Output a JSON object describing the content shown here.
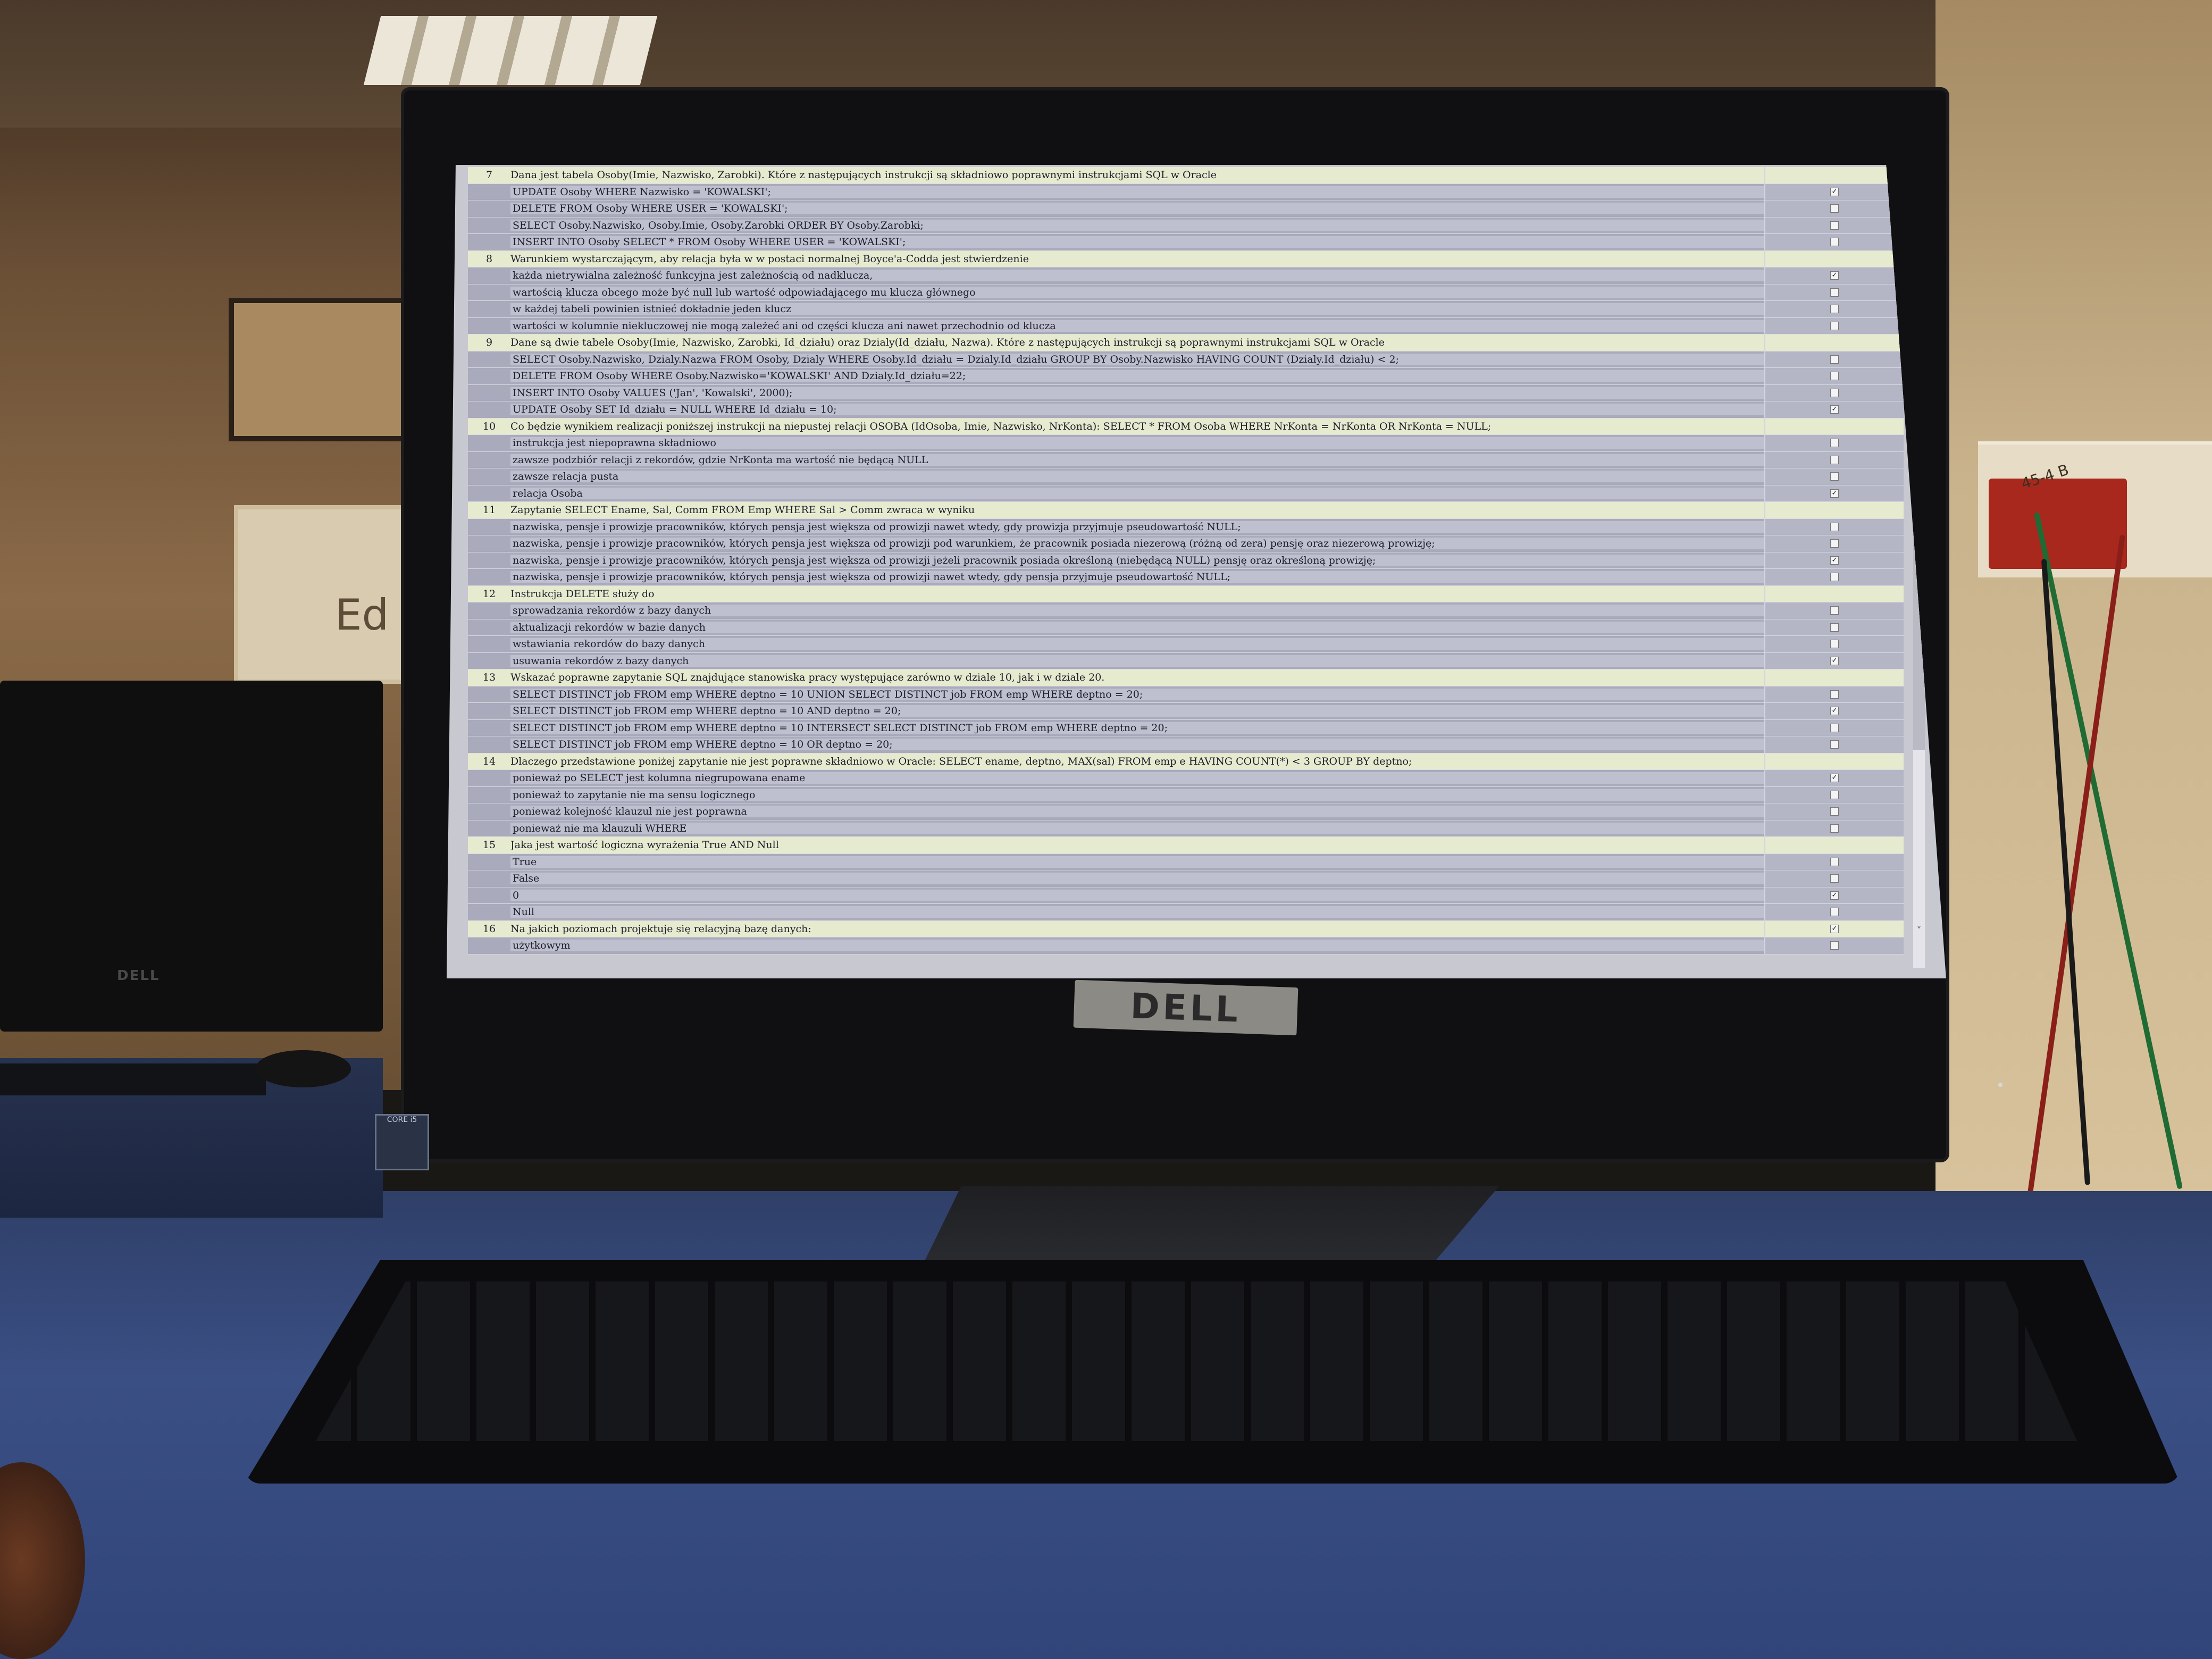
{
  "monitor": {
    "brand": "DELL",
    "left_monitor_brand": "DELL",
    "sticker": "CORE i5"
  },
  "outlet_label": "45-4 B",
  "whiteboard_text": "Ed",
  "colors": {
    "question_row": "#e6ebcf",
    "answer_row": "#a9aabb",
    "screen_bg": "#c8c9d0"
  },
  "questions": [
    {
      "number": "7",
      "text": "Dana jest tabela Osoby(Imie, Nazwisko, Zarobki). Które z następujących instrukcji są składniowo poprawnymi instrukcjami SQL w Oracle",
      "answers": [
        {
          "text": "UPDATE Osoby WHERE Nazwisko = 'KOWALSKI';",
          "checked": true
        },
        {
          "text": "DELETE FROM Osoby WHERE USER = 'KOWALSKI';",
          "checked": false
        },
        {
          "text": "SELECT Osoby.Nazwisko, Osoby.Imie, Osoby.Zarobki ORDER BY Osoby.Zarobki;",
          "checked": false
        },
        {
          "text": "INSERT INTO Osoby SELECT * FROM Osoby WHERE USER = 'KOWALSKI';",
          "checked": false
        }
      ]
    },
    {
      "number": "8",
      "text": "Warunkiem wystarczającym, aby relacja była w w postaci normalnej Boyce'a-Codda jest stwierdzenie",
      "answers": [
        {
          "text": "każda nietrywialna zależność funkcyjna jest zależnością od nadklucza,",
          "checked": true
        },
        {
          "text": "wartością klucza obcego może być null lub wartość odpowiadającego mu klucza głównego",
          "checked": false
        },
        {
          "text": "w każdej tabeli powinien istnieć dokładnie jeden klucz",
          "checked": false
        },
        {
          "text": "wartości w kolumnie niekluczowej nie mogą zależeć ani od części klucza ani nawet przechodnio od klucza",
          "checked": false
        }
      ]
    },
    {
      "number": "9",
      "text": "Dane są dwie tabele Osoby(Imie, Nazwisko, Zarobki, Id_działu) oraz Dzialy(Id_działu, Nazwa). Które z następujących instrukcji są poprawnymi instrukcjami SQL w Oracle",
      "answers": [
        {
          "text": "SELECT Osoby.Nazwisko, Dzialy.Nazwa FROM Osoby, Dzialy WHERE Osoby.Id_działu = Dzialy.Id_działu GROUP BY Osoby.Nazwisko HAVING COUNT (Dzialy.Id_działu) < 2;",
          "checked": false
        },
        {
          "text": "DELETE FROM Osoby WHERE Osoby.Nazwisko='KOWALSKI' AND Dzialy.Id_działu=22;",
          "checked": false
        },
        {
          "text": "INSERT INTO Osoby VALUES ('Jan', 'Kowalski', 2000);",
          "checked": false
        },
        {
          "text": "UPDATE Osoby SET Id_działu = NULL WHERE Id_działu = 10;",
          "checked": true
        }
      ]
    },
    {
      "number": "10",
      "text": "Co będzie wynikiem realizacji poniższej instrukcji na niepustej relacji OSOBA (IdOsoba, Imie, Nazwisko, NrKonta): SELECT * FROM Osoba WHERE NrKonta = NrKonta OR NrKonta = NULL;",
      "answers": [
        {
          "text": "instrukcja jest niepoprawna składniowo",
          "checked": false
        },
        {
          "text": "zawsze podzbiór relacji z rekordów, gdzie NrKonta ma wartość nie będącą NULL",
          "checked": false
        },
        {
          "text": "zawsze relacja pusta",
          "checked": false
        },
        {
          "text": "relacja Osoba",
          "checked": true
        }
      ]
    },
    {
      "number": "11",
      "text": "Zapytanie SELECT Ename, Sal, Comm FROM Emp WHERE Sal > Comm zwraca w wyniku",
      "answers": [
        {
          "text": "nazwiska, pensje i prowizje pracowników, których pensja jest większa od prowizji nawet wtedy, gdy prowizja przyjmuje pseudowartość NULL;",
          "checked": false
        },
        {
          "text": "nazwiska, pensje i prowizje pracowników, których pensja jest większa od prowizji pod warunkiem, że pracownik posiada niezerową (różną od zera) pensję oraz niezerową prowizję;",
          "checked": false
        },
        {
          "text": "nazwiska, pensje i prowizje pracowników, których pensja jest większa od prowizji jeżeli pracownik posiada określoną (niebędącą NULL) pensję oraz określoną prowizję;",
          "checked": true
        },
        {
          "text": "nazwiska, pensje i prowizje pracowników, których pensja jest większa od prowizji nawet wtedy, gdy pensja przyjmuje pseudowartość NULL;",
          "checked": false
        }
      ]
    },
    {
      "number": "12",
      "text": "Instrukcja DELETE służy do",
      "answers": [
        {
          "text": "sprowadzania rekordów z bazy danych",
          "checked": false
        },
        {
          "text": "aktualizacji rekordów w bazie danych",
          "checked": false
        },
        {
          "text": "wstawiania rekordów do bazy danych",
          "checked": false
        },
        {
          "text": "usuwania rekordów z bazy danych",
          "checked": true
        }
      ]
    },
    {
      "number": "13",
      "text": "Wskazać poprawne zapytanie SQL znajdujące stanowiska pracy występujące zarówno w dziale 10, jak i w dziale 20.",
      "answers": [
        {
          "text": "SELECT DISTINCT job FROM emp WHERE deptno = 10 UNION SELECT DISTINCT job FROM emp WHERE deptno = 20;",
          "checked": false
        },
        {
          "text": "SELECT DISTINCT job FROM emp WHERE deptno = 10 AND deptno = 20;",
          "checked": true
        },
        {
          "text": "SELECT DISTINCT job FROM emp WHERE deptno = 10 INTERSECT SELECT DISTINCT job FROM emp WHERE deptno = 20;",
          "checked": false
        },
        {
          "text": "SELECT DISTINCT job FROM emp WHERE deptno = 10 OR deptno = 20;",
          "checked": false
        }
      ]
    },
    {
      "number": "14",
      "text": "Dlaczego przedstawione poniżej zapytanie nie jest poprawne składniowo w Oracle: SELECT ename, deptno, MAX(sal) FROM emp e HAVING COUNT(*) < 3 GROUP BY deptno;",
      "answers": [
        {
          "text": "ponieważ po SELECT jest kolumna niegrupowana ename",
          "checked": true
        },
        {
          "text": "ponieważ to zapytanie nie ma sensu logicznego",
          "checked": false
        },
        {
          "text": "ponieważ kolejność klauzul nie jest poprawna",
          "checked": false
        },
        {
          "text": "ponieważ nie ma klauzuli WHERE",
          "checked": false
        }
      ]
    },
    {
      "number": "15",
      "text": "Jaka jest wartość logiczna wyrażenia True AND Null",
      "answers": [
        {
          "text": "True",
          "checked": false
        },
        {
          "text": "False",
          "checked": false
        },
        {
          "text": "0",
          "checked": true
        },
        {
          "text": "Null",
          "checked": false
        }
      ]
    },
    {
      "number": "16",
      "text": "Na jakich poziomach projektuje się relacyjną bazę danych:",
      "checked": true,
      "answers": [
        {
          "text": "użytkowym",
          "checked": false
        }
      ]
    }
  ]
}
